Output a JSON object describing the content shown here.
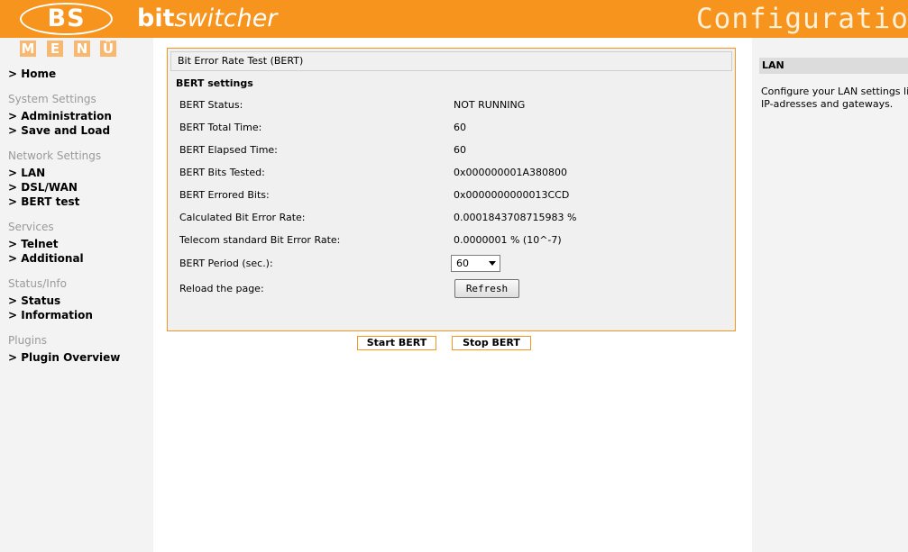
{
  "header": {
    "logo_text": "BS",
    "brand_bold": "bit",
    "brand_italic": "switcher",
    "section_title": "Configuration"
  },
  "menu_letters": [
    "M",
    "E",
    "N",
    "Ü"
  ],
  "sidebar": {
    "home": "> Home",
    "groups": [
      {
        "heading": "System Settings",
        "items": [
          "> Administration",
          "> Save and Load"
        ]
      },
      {
        "heading": "Network Settings",
        "items": [
          "> LAN",
          "> DSL/WAN",
          "> BERT test"
        ]
      },
      {
        "heading": "Services",
        "items": [
          "> Telnet",
          "> Additional"
        ]
      },
      {
        "heading": "Status/Info",
        "items": [
          "> Status",
          "> Information"
        ]
      },
      {
        "heading": "Plugins",
        "items": [
          "> Plugin Overview"
        ]
      }
    ]
  },
  "panel": {
    "title": "Bit Error Rate Test (BERT)",
    "section": "BERT settings",
    "rows": [
      {
        "label": "BERT Status:",
        "value": "NOT RUNNING"
      },
      {
        "label": "BERT Total Time:",
        "value": "60"
      },
      {
        "label": "BERT Elapsed Time:",
        "value": "60"
      },
      {
        "label": "BERT Bits Tested:",
        "value": "0x000000001A380800"
      },
      {
        "label": "BERT Errored Bits:",
        "value": "0x0000000000013CCD"
      },
      {
        "label": "Calculated Bit Error Rate:",
        "value": "0.0001843708715983 %"
      },
      {
        "label": "Telecom standard Bit Error Rate:",
        "value": "0.0000001 % (10^-7)"
      }
    ],
    "period_label": "BERT Period (sec.):",
    "period_value": "60",
    "reload_label": "Reload the page:",
    "refresh_label": "Refresh"
  },
  "actions": {
    "start": "Start BERT",
    "stop": "Stop BERT"
  },
  "help": {
    "title": "LAN",
    "text_line1": "Configure your LAN settings li",
    "text_line2": "IP-adresses and gateways."
  },
  "colors": {
    "accent": "#f7941d",
    "sidebar_bg": "#f3f3f3",
    "panel_bg": "#f0f0f0"
  }
}
